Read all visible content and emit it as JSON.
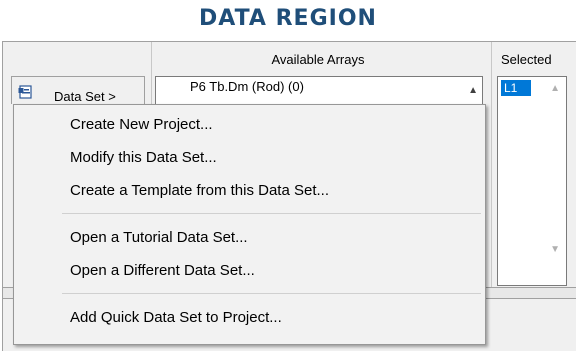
{
  "header": {
    "title": "DATA REGION"
  },
  "panel": {
    "available_header": "Available Arrays",
    "selected_header": "Selected",
    "dataset_button_label": "Data Set >",
    "arrays_list_item": "P6 Tb.Dm (Rod) (0)",
    "selected_list_item": "L1"
  },
  "menu": {
    "items": [
      "Create New Project...",
      "Modify this Data Set...",
      "Create a Template from this Data Set...",
      "Open a Tutorial Data Set...",
      "Open a Different Data Set...",
      "Add Quick Data Set to Project..."
    ]
  },
  "colors": {
    "title": "#1f4e79",
    "selection": "#0078d7",
    "menu_background": "#f2f2f2"
  },
  "icons": [
    "dataset-icon",
    "chevron-up-icon",
    "chevron-down-icon"
  ]
}
